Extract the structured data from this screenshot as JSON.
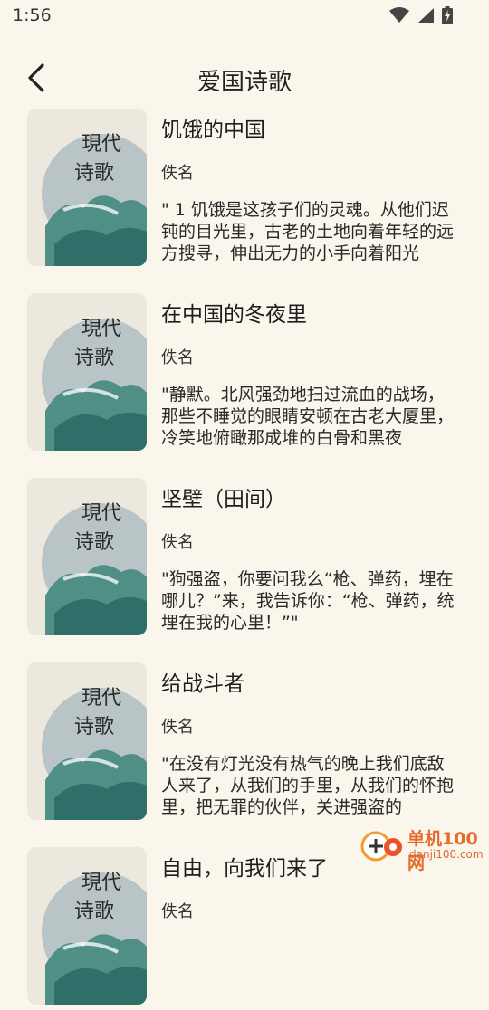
{
  "status_bar": {
    "time": "1:56",
    "icons": [
      "wifi-icon",
      "signal-icon",
      "battery-charging-icon"
    ]
  },
  "header": {
    "back_icon": "chevron-left-icon",
    "title": "爱国诗歌"
  },
  "cover": {
    "line1": "現代",
    "line2": "诗歌"
  },
  "poems": [
    {
      "title": "饥饿的中国",
      "author": "佚名",
      "excerpt": "\" 1 饥饿是这孩子们的灵魂。从他们迟钝的目光里，古老的土地向着年轻的远方搜寻，伸出无力的小手向着阳光"
    },
    {
      "title": "在中国的冬夜里",
      "author": "佚名",
      "excerpt": "\"静默。北风强劲地扫过流血的战场，那些不睡觉的眼睛安顿在古老大厦里，冷笑地俯瞰那成堆的白骨和黑夜"
    },
    {
      "title": "坚壁（田间）",
      "author": "佚名",
      "excerpt": "\"狗强盗，你要问我么“枪、弹药，埋在哪儿？”来，我告诉你：“枪、弹药，统埋在我的心里！”\""
    },
    {
      "title": "给战斗者",
      "author": "佚名",
      "excerpt": "\"在没有灯光没有热气的晚上我们底敌人来了，从我们的手里，从我们的怀抱里，把无罪的伙伴，关进强盗的"
    },
    {
      "title": "自由，向我们来了",
      "author": "佚名",
      "excerpt": ""
    }
  ],
  "watermark": {
    "name": "单机100网",
    "url": "danji100.com"
  }
}
